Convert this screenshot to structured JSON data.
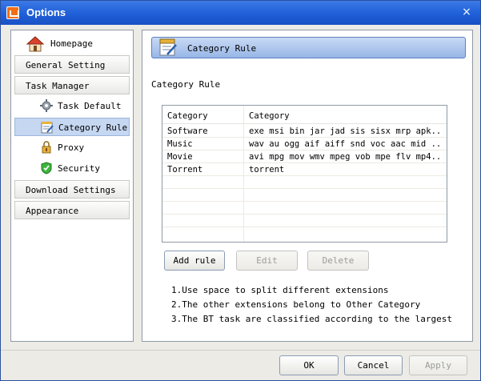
{
  "window": {
    "title": "Options",
    "close_symbol": "×"
  },
  "sidebar": {
    "homepage": "Homepage",
    "general_setting": "General Setting",
    "task_manager": "Task Manager",
    "task_default": "Task Default",
    "category_rule": "Category Rule",
    "proxy": "Proxy",
    "security": "Security",
    "download_settings": "Download Settings",
    "appearance": "Appearance"
  },
  "content": {
    "banner_title": "Category Rule",
    "section_label": "Category Rule",
    "table": {
      "headers": [
        "Category",
        "Category"
      ],
      "rows": [
        [
          "Software",
          "exe msi bin jar jad sis sisx mrp apk..."
        ],
        [
          "Music",
          "wav au ogg aif aiff snd voc aac mid ..."
        ],
        [
          "Movie",
          "avi mpg mov wmv mpeg vob mpe flv mp4..."
        ],
        [
          "Torrent",
          "torrent"
        ]
      ]
    },
    "buttons": {
      "add_rule": "Add rule",
      "edit": "Edit",
      "delete": "Delete"
    },
    "notes": [
      "1.Use space to split different extensions",
      "2.The other extensions belong to Other Category",
      "3.The BT task are classified according to the largest"
    ]
  },
  "footer": {
    "ok": "OK",
    "cancel": "Cancel",
    "apply": "Apply"
  },
  "colors": {
    "titlebar": "#1f5fd8",
    "selected": "#c5d7f1",
    "banner": "#97b6e6"
  }
}
